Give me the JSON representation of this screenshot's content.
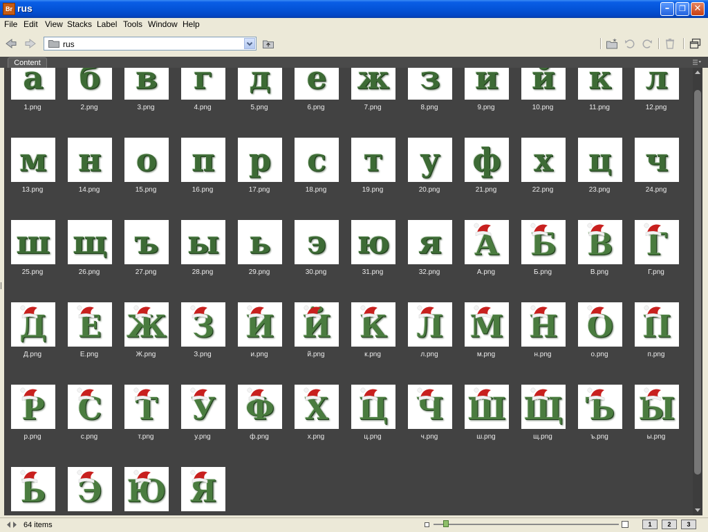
{
  "window": {
    "title": "rus",
    "app_badge": "Br"
  },
  "menu": [
    "File",
    "Edit",
    "View",
    "Stacks",
    "Label",
    "Tools",
    "Window",
    "Help"
  ],
  "path": {
    "folder": "rus"
  },
  "panel": {
    "tab": "Content"
  },
  "status": {
    "count": "64 items"
  },
  "view_buttons": [
    "1",
    "2",
    "3"
  ],
  "items": [
    {
      "glyph": "а",
      "file": "1.png",
      "hat": false
    },
    {
      "glyph": "б",
      "file": "2.png",
      "hat": false
    },
    {
      "glyph": "в",
      "file": "3.png",
      "hat": false
    },
    {
      "glyph": "г",
      "file": "4.png",
      "hat": false
    },
    {
      "glyph": "д",
      "file": "5.png",
      "hat": false
    },
    {
      "glyph": "е",
      "file": "6.png",
      "hat": false
    },
    {
      "glyph": "ж",
      "file": "7.png",
      "hat": false
    },
    {
      "glyph": "з",
      "file": "8.png",
      "hat": false
    },
    {
      "glyph": "и",
      "file": "9.png",
      "hat": false
    },
    {
      "glyph": "й",
      "file": "10.png",
      "hat": false
    },
    {
      "glyph": "к",
      "file": "11.png",
      "hat": false
    },
    {
      "glyph": "л",
      "file": "12.png",
      "hat": false
    },
    {
      "glyph": "м",
      "file": "13.png",
      "hat": false
    },
    {
      "glyph": "н",
      "file": "14.png",
      "hat": false
    },
    {
      "glyph": "о",
      "file": "15.png",
      "hat": false
    },
    {
      "glyph": "п",
      "file": "16.png",
      "hat": false
    },
    {
      "glyph": "р",
      "file": "17.png",
      "hat": false
    },
    {
      "glyph": "с",
      "file": "18.png",
      "hat": false
    },
    {
      "glyph": "т",
      "file": "19.png",
      "hat": false
    },
    {
      "glyph": "у",
      "file": "20.png",
      "hat": false
    },
    {
      "glyph": "ф",
      "file": "21.png",
      "hat": false
    },
    {
      "glyph": "х",
      "file": "22.png",
      "hat": false
    },
    {
      "glyph": "ц",
      "file": "23.png",
      "hat": false
    },
    {
      "glyph": "ч",
      "file": "24.png",
      "hat": false
    },
    {
      "glyph": "ш",
      "file": "25.png",
      "hat": false
    },
    {
      "glyph": "щ",
      "file": "26.png",
      "hat": false
    },
    {
      "glyph": "ъ",
      "file": "27.png",
      "hat": false
    },
    {
      "glyph": "ы",
      "file": "28.png",
      "hat": false
    },
    {
      "glyph": "ь",
      "file": "29.png",
      "hat": false
    },
    {
      "glyph": "э",
      "file": "30.png",
      "hat": false
    },
    {
      "glyph": "ю",
      "file": "31.png",
      "hat": false
    },
    {
      "glyph": "я",
      "file": "32.png",
      "hat": false
    },
    {
      "glyph": "А",
      "file": "А.png",
      "hat": true
    },
    {
      "glyph": "Б",
      "file": "Б.png",
      "hat": true
    },
    {
      "glyph": "В",
      "file": "В.png",
      "hat": true
    },
    {
      "glyph": "Г",
      "file": "Г.png",
      "hat": true
    },
    {
      "glyph": "Д",
      "file": "Д.png",
      "hat": true
    },
    {
      "glyph": "Е",
      "file": "Е.png",
      "hat": true
    },
    {
      "glyph": "Ж",
      "file": "Ж.png",
      "hat": true
    },
    {
      "glyph": "З",
      "file": "З.png",
      "hat": true
    },
    {
      "glyph": "И",
      "file": "и.png",
      "hat": true
    },
    {
      "glyph": "Й",
      "file": "й.png",
      "hat": true
    },
    {
      "glyph": "К",
      "file": "к.png",
      "hat": true
    },
    {
      "glyph": "Л",
      "file": "л.png",
      "hat": true
    },
    {
      "glyph": "М",
      "file": "м.png",
      "hat": true
    },
    {
      "glyph": "Н",
      "file": "н.png",
      "hat": true
    },
    {
      "glyph": "О",
      "file": "о.png",
      "hat": true
    },
    {
      "glyph": "П",
      "file": "п.png",
      "hat": true
    },
    {
      "glyph": "Р",
      "file": "р.png",
      "hat": true
    },
    {
      "glyph": "С",
      "file": "с.png",
      "hat": true
    },
    {
      "glyph": "Т",
      "file": "т.png",
      "hat": true
    },
    {
      "glyph": "У",
      "file": "у.png",
      "hat": true
    },
    {
      "glyph": "Ф",
      "file": "ф.png",
      "hat": true
    },
    {
      "glyph": "Х",
      "file": "х.png",
      "hat": true
    },
    {
      "glyph": "Ц",
      "file": "ц.png",
      "hat": true
    },
    {
      "glyph": "Ч",
      "file": "ч.png",
      "hat": true
    },
    {
      "glyph": "Ш",
      "file": "ш.png",
      "hat": true
    },
    {
      "glyph": "Щ",
      "file": "щ.png",
      "hat": true
    },
    {
      "glyph": "Ъ",
      "file": "ъ.png",
      "hat": true
    },
    {
      "glyph": "Ы",
      "file": "ы.png",
      "hat": true
    },
    {
      "glyph": "Ь",
      "file": "",
      "hat": true
    },
    {
      "glyph": "Э",
      "file": "",
      "hat": true
    },
    {
      "glyph": "Ю",
      "file": "",
      "hat": true
    },
    {
      "glyph": "Я",
      "file": "",
      "hat": true
    }
  ],
  "icons": {
    "app": "bridge-app-icon",
    "back": "back-arrow-icon",
    "forward": "forward-arrow-icon",
    "folder": "folder-icon",
    "up": "folder-up-icon",
    "new_folder": "new-folder-icon",
    "rotate_left": "rotate-left-icon",
    "rotate_right": "rotate-right-icon",
    "delete": "trash-icon",
    "compact": "compact-mode-icon"
  },
  "colors": {
    "titlebar": "#0454d8",
    "panel_bg": "#424242",
    "letter": "#3d6b35",
    "hat": "#c8201e"
  }
}
